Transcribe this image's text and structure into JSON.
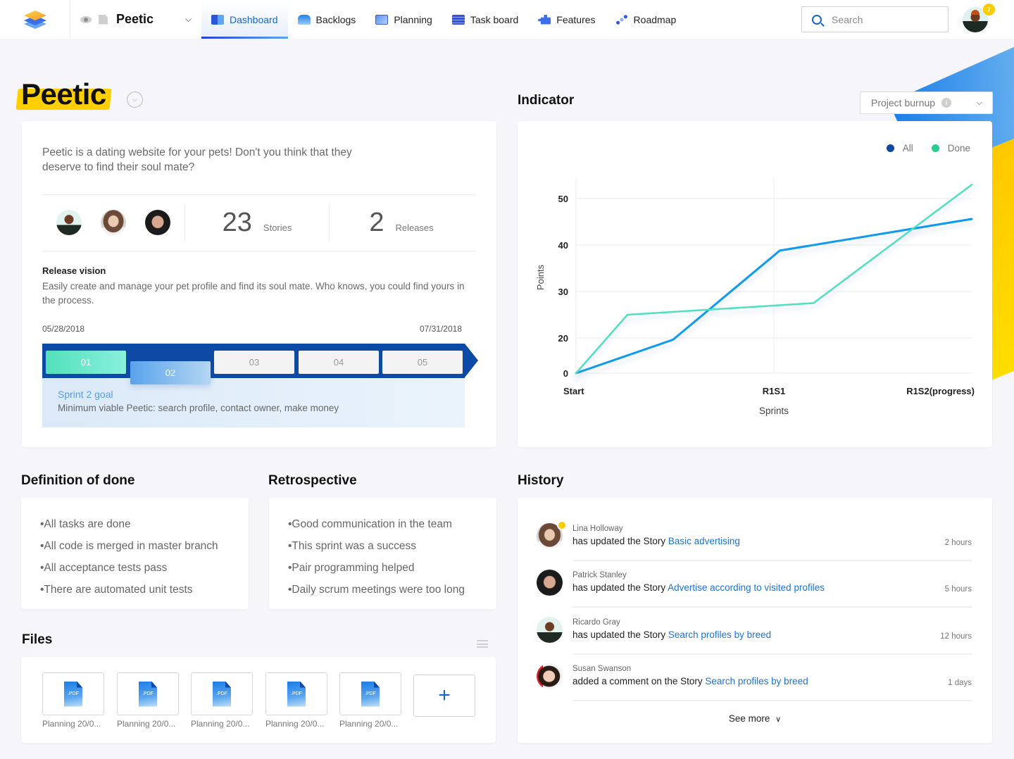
{
  "nav": {
    "project_name": "Peetic",
    "items": [
      {
        "label": "Dashboard",
        "icon": "dashboard-icon",
        "active": true
      },
      {
        "label": "Backlogs",
        "icon": "backlogs-icon",
        "active": false
      },
      {
        "label": "Planning",
        "icon": "planning-icon",
        "active": false
      },
      {
        "label": "Task board",
        "icon": "taskboard-icon",
        "active": false
      },
      {
        "label": "Features",
        "icon": "features-icon",
        "active": false
      },
      {
        "label": "Roadmap",
        "icon": "roadmap-icon",
        "active": false
      }
    ],
    "search_placeholder": "Search",
    "notification_count": "7"
  },
  "project": {
    "title": "Peetic",
    "description": "Peetic is a dating website for your pets! Don't you think that they deserve to find their soul mate?",
    "stories_count": "23",
    "stories_label": "Stories",
    "releases_count": "2",
    "releases_label": "Releases",
    "release_vision_title": "Release vision",
    "release_vision_text": "Easily create and manage your pet profile and find its soul mate. Who knows, you could find yours in the process.",
    "start_date": "05/28/2018",
    "end_date": "07/31/2018",
    "sprints": [
      "01",
      "02",
      "03",
      "04",
      "05"
    ],
    "current_sprint_index": 1,
    "goal_title": "Sprint 2 goal",
    "goal_text": "Minimum viable Peetic: search profile, contact owner, make money"
  },
  "indicator": {
    "title": "Indicator",
    "select_value": "Project burnup",
    "info_glyph": "i"
  },
  "chart_data": {
    "type": "line",
    "title": "Project burnup",
    "xlabel": "Sprints",
    "ylabel": "Points",
    "categories": [
      "Start",
      "R1S1",
      "R1S2(progress)"
    ],
    "yticks": [
      0,
      20,
      30,
      40,
      50
    ],
    "ylim": [
      0,
      55
    ],
    "grid": true,
    "legend_position": "top-right",
    "series": [
      {
        "name": "All",
        "color": "#0a9af0",
        "legend_color": "#0c4aa6",
        "points": [
          [
            0,
            0
          ],
          [
            0.49,
            19
          ],
          [
            1.03,
            38.8
          ],
          [
            2,
            45.6
          ]
        ]
      },
      {
        "name": "Done",
        "color": "#4fe0c0",
        "legend_color": "#25d08a",
        "points": [
          [
            0,
            0
          ],
          [
            0.26,
            25
          ],
          [
            1.2,
            27.5
          ],
          [
            2,
            53
          ]
        ]
      }
    ]
  },
  "dod": {
    "title": "Definition of done",
    "items": [
      "•All tasks are done",
      "•All code is merged in master branch",
      "•All acceptance tests pass",
      "•There are automated unit tests"
    ]
  },
  "retro": {
    "title": "Retrospective",
    "items": [
      "•Good communication in the team",
      "•This sprint was a success",
      "•Pair programming helped",
      "•Daily scrum meetings were too long"
    ]
  },
  "files": {
    "title": "Files",
    "items": [
      "Planning 20/0...",
      "Planning 20/0...",
      "Planning 20/0...",
      "Planning 20/0...",
      "Planning 20/0..."
    ],
    "file_type": ".PDF",
    "add_label": "+"
  },
  "history": {
    "title": "History",
    "items": [
      {
        "name": "Lina Holloway",
        "action": "has updated the Story ",
        "link": "Basic advertising",
        "time": "2 hours"
      },
      {
        "name": "Patrick Stanley",
        "action": "has updated the Story ",
        "link": "Advertise according to visited profiles",
        "time": "5 hours"
      },
      {
        "name": "Ricardo Gray",
        "action": "has updated the Story ",
        "link": "Search profiles by breed",
        "time": "12 hours"
      },
      {
        "name": "Susan Swanson",
        "action": "added a comment on the Story ",
        "link": "Search profiles by breed",
        "time": "1 days"
      }
    ],
    "see_more": "See more"
  }
}
